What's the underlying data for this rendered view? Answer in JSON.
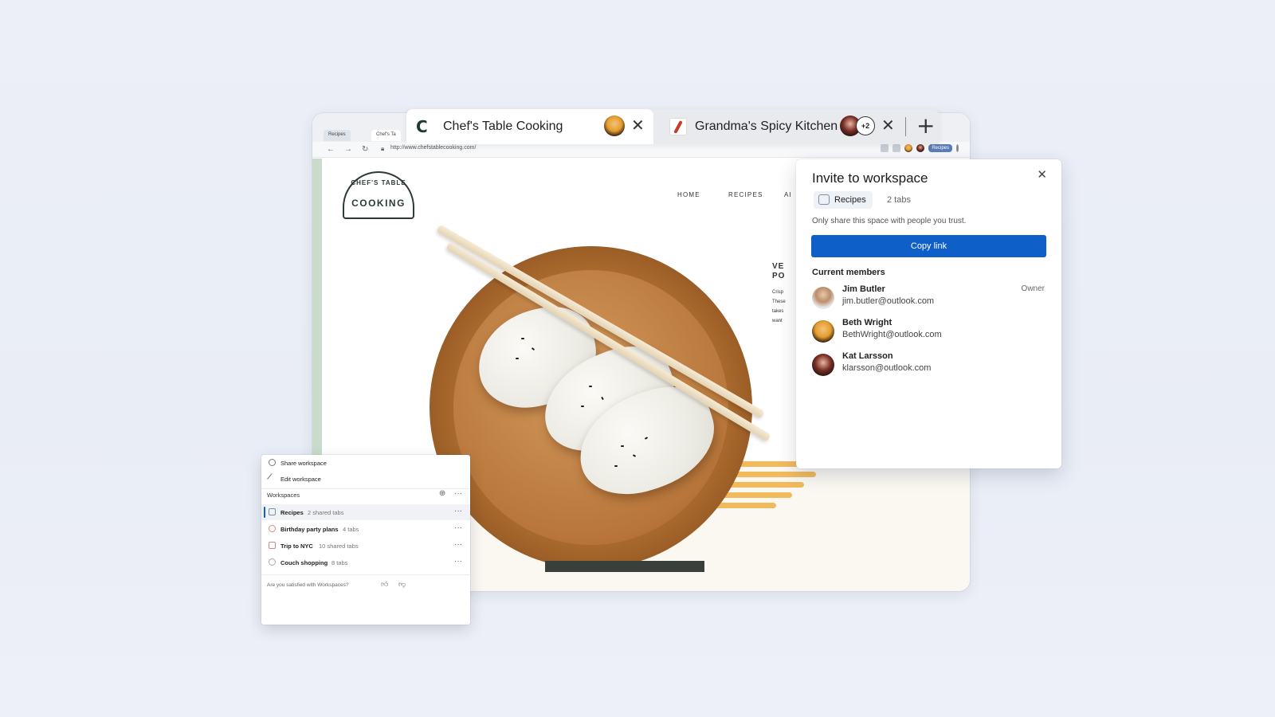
{
  "browser": {
    "mini_tabs": [
      "Recipes",
      "Chef's Ta"
    ],
    "url": "http://www.chefstablecooking.com/",
    "workspace_pill": "Recipes"
  },
  "tabs": [
    {
      "title": "Chef's Table Cooking",
      "favicon": "chefs-table-c-icon",
      "active": true
    },
    {
      "title": "Grandma's Spicy Kitchen",
      "favicon": "chili-icon",
      "active": false,
      "extra_members": "+2"
    }
  ],
  "site": {
    "logo_top": "CHEF'S TABLE",
    "logo_bottom": "COOKING",
    "nav": [
      "HOME",
      "RECIPES",
      "AI"
    ],
    "hero_heading": [
      "VE",
      "PO"
    ],
    "hero_body": [
      "Crisp",
      "These",
      "takes",
      "want"
    ]
  },
  "invite": {
    "title": "Invite to workspace",
    "workspace_name": "Recipes",
    "tab_count": "2 tabs",
    "trust_note": "Only share this space with people you trust.",
    "copy_link_label": "Copy link",
    "members_heading": "Current members",
    "members": [
      {
        "name": "Jim Butler",
        "email": "jim.butler@outlook.com",
        "role": "Owner"
      },
      {
        "name": "Beth Wright",
        "email": "BethWright@outlook.com",
        "role": ""
      },
      {
        "name": "Kat Larsson",
        "email": "klarsson@outlook.com",
        "role": ""
      }
    ]
  },
  "workspace_menu": {
    "share_label": "Share workspace",
    "edit_label": "Edit workspace",
    "header": "Workspaces",
    "items": [
      {
        "name": "Recipes",
        "sub": "2 shared tabs",
        "selected": true
      },
      {
        "name": "Birthday party plans",
        "sub": "4 tabs",
        "selected": false
      },
      {
        "name": "Trip to NYC",
        "sub": "10 shared tabs",
        "selected": false
      },
      {
        "name": "Couch shopping",
        "sub": "8 tabs",
        "selected": false
      }
    ],
    "feedback_prompt": "Are you satisfied with Workspaces?"
  },
  "colors": {
    "accent": "#0f5fc9",
    "squiggle": "#f0b24d",
    "bowl": "#b06f30"
  }
}
